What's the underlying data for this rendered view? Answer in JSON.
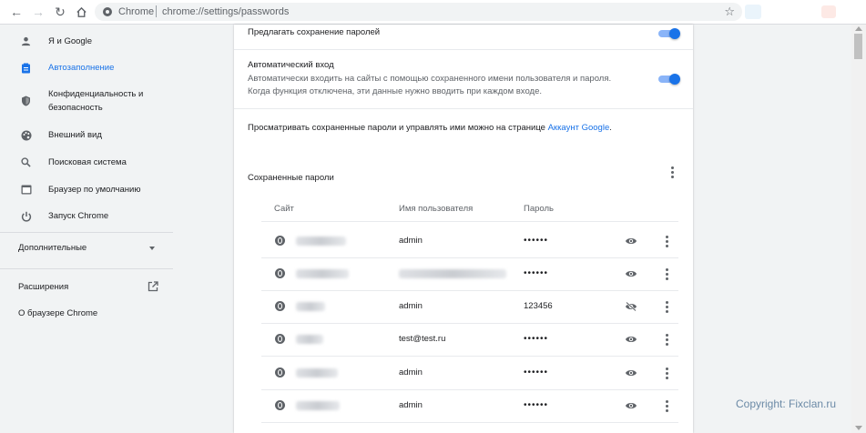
{
  "browser": {
    "chip": "Chrome",
    "url": "chrome://settings/passwords"
  },
  "sidebar": {
    "items": [
      {
        "label": "Я и Google",
        "icon": "person-icon"
      },
      {
        "label": "Автозаполнение",
        "icon": "clipboard-icon",
        "active": true
      },
      {
        "label1": "Конфиденциальность и",
        "label2": "безопасность",
        "icon": "shield-icon"
      },
      {
        "label": "Внешний вид",
        "icon": "palette-icon"
      },
      {
        "label": "Поисковая система",
        "icon": "search-icon"
      },
      {
        "label": "Браузер по умолчанию",
        "icon": "browser-icon"
      },
      {
        "label": "Запуск Chrome",
        "icon": "power-icon"
      }
    ],
    "advanced": "Дополнительные",
    "extensions": "Расширения",
    "about": "О браузере Chrome"
  },
  "settings": {
    "offer_save": "Предлагать сохранение паролей",
    "autologin_title": "Автоматический вход",
    "autologin_desc1": "Автоматически входить на сайты с помощью сохраненного имени пользователя и пароля.",
    "autologin_desc2": "Когда функция отключена, эти данные нужно вводить при каждом входе.",
    "manage_text": "Просматривать сохраненные пароли и управлять ими можно на странице ",
    "manage_link": "Аккаунт Google",
    "manage_end": "."
  },
  "passwords": {
    "section_title": "Сохраненные пароли",
    "col_site": "Сайт",
    "col_user": "Имя пользователя",
    "col_pass": "Пароль",
    "rows": [
      {
        "user": "admin",
        "password": "••••••"
      },
      {
        "user": "",
        "password": "••••••"
      },
      {
        "user": "admin",
        "password": "123456"
      },
      {
        "user": "test@test.ru",
        "password": "••••••"
      },
      {
        "user": "admin",
        "password": "••••••"
      },
      {
        "user": "admin",
        "password": "••••••"
      }
    ]
  },
  "footer": {
    "copyright": "Copyright: Fixclan.ru"
  },
  "colors": {
    "accent": "#1a73e8",
    "text": "#202124",
    "muted": "#5f6368"
  }
}
